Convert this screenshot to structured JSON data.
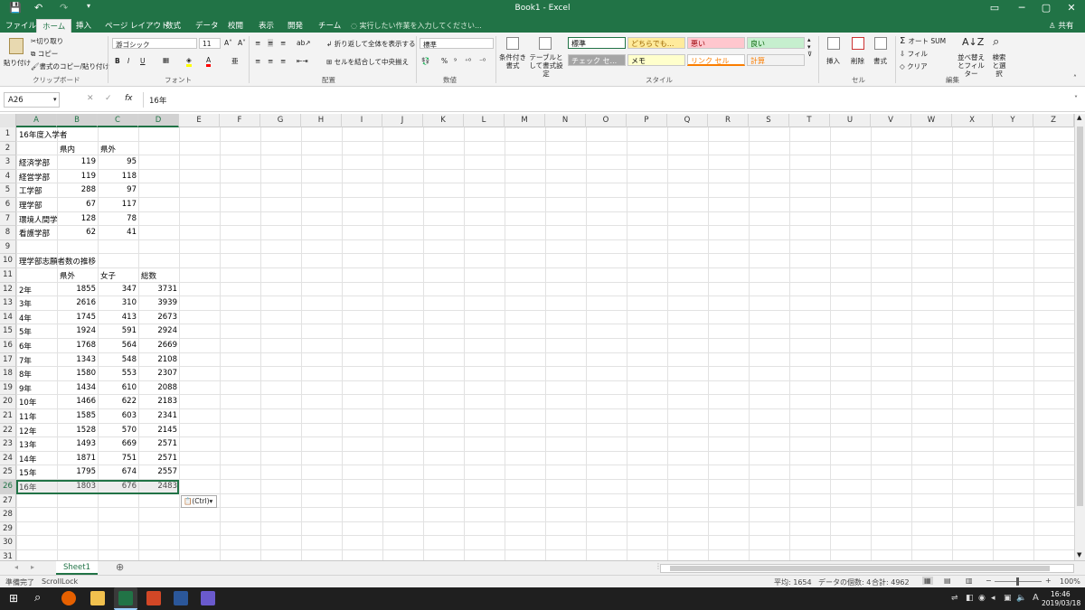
{
  "window": {
    "title": "Book1 - Excel",
    "share": "共有",
    "controls": {
      "ribbon": "▭",
      "min": "─",
      "max": "▢",
      "close": "✕"
    }
  },
  "quick_access": {
    "save": "💾",
    "undo": "↶",
    "redo": "↷",
    "more": "▾"
  },
  "tabs": [
    {
      "label": "ファイル"
    },
    {
      "label": "ホーム"
    },
    {
      "label": "挿入"
    },
    {
      "label": "ページ レイアウト"
    },
    {
      "label": "数式"
    },
    {
      "label": "データ"
    },
    {
      "label": "校閲"
    },
    {
      "label": "表示"
    },
    {
      "label": "開発"
    },
    {
      "label": "チーム"
    }
  ],
  "tell_me": "実行したい作業を入力してください...",
  "ribbon": {
    "clipboard": {
      "paste": "貼り付け",
      "cut": "切り取り",
      "copy": "コピー",
      "format_painter": "書式のコピー/貼り付け",
      "group": "クリップボード"
    },
    "font": {
      "name": "游ゴシック",
      "size": "11",
      "bold": "B",
      "italic": "I",
      "underline": "U",
      "group": "フォント"
    },
    "alignment": {
      "wrap": "折り返して全体を表示する",
      "merge": "セルを結合して中央揃え",
      "group": "配置"
    },
    "number": {
      "format": "標準",
      "percent": "%",
      "comma": "⁹",
      "group": "数値"
    },
    "styles": {
      "conditional": "条件付き書式",
      "table": "テーブルとして書式設定",
      "cells": [
        {
          "label": "標準",
          "bg": "#ffffff",
          "fg": "#000000"
        },
        {
          "label": "どちらでも...",
          "bg": "#ffeb9c",
          "fg": "#9c6500"
        },
        {
          "label": "悪い",
          "bg": "#ffc7ce",
          "fg": "#9c0006"
        },
        {
          "label": "良い",
          "bg": "#c6efce",
          "fg": "#006100"
        },
        {
          "label": "チェック セ...",
          "bg": "#a5a5a5",
          "fg": "#ffffff"
        },
        {
          "label": "メモ",
          "bg": "#ffffcc",
          "fg": "#000000"
        },
        {
          "label": "リンク セル",
          "bg": "#ffffff",
          "fg": "#fa7d00"
        },
        {
          "label": "計算",
          "bg": "#f2f2f2",
          "fg": "#fa7d00"
        }
      ],
      "group": "スタイル"
    },
    "cells": {
      "insert": "挿入",
      "delete": "削除",
      "format": "書式",
      "group": "セル"
    },
    "editing": {
      "autosum": "オート SUM",
      "fill": "フィル",
      "clear": "クリア",
      "sort": "並べ替えとフィルター",
      "find": "検索と選択",
      "group": "編集"
    }
  },
  "formula_bar": {
    "name_box": "A26",
    "cancel": "✕",
    "enter": "✓",
    "fx": "fx",
    "value": "16年"
  },
  "columns": [
    "A",
    "B",
    "C",
    "D",
    "E",
    "F",
    "G",
    "H",
    "I",
    "J",
    "K",
    "L",
    "M",
    "N",
    "O",
    "P",
    "Q",
    "R",
    "S",
    "T",
    "U",
    "V",
    "W",
    "X",
    "Y",
    "Z"
  ],
  "rows": [
    [
      "16年度入学者",
      "",
      "",
      ""
    ],
    [
      "",
      "県内",
      "県外",
      ""
    ],
    [
      "経済学部",
      "119",
      "95",
      ""
    ],
    [
      "経営学部",
      "119",
      "118",
      ""
    ],
    [
      "工学部",
      "288",
      "97",
      ""
    ],
    [
      "理学部",
      "67",
      "117",
      ""
    ],
    [
      "環境人間学",
      "128",
      "78",
      ""
    ],
    [
      "看護学部",
      "62",
      "41",
      ""
    ],
    [
      "",
      "",
      "",
      ""
    ],
    [
      "理学部志願者数の推移",
      "",
      "",
      ""
    ],
    [
      "",
      "県外",
      "女子",
      "総数"
    ],
    [
      "2年",
      "1855",
      "347",
      "3731"
    ],
    [
      "3年",
      "2616",
      "310",
      "3939"
    ],
    [
      "4年",
      "1745",
      "413",
      "2673"
    ],
    [
      "5年",
      "1924",
      "591",
      "2924"
    ],
    [
      "6年",
      "1768",
      "564",
      "2669"
    ],
    [
      "7年",
      "1343",
      "548",
      "2108"
    ],
    [
      "8年",
      "1580",
      "553",
      "2307"
    ],
    [
      "9年",
      "1434",
      "610",
      "2088"
    ],
    [
      "10年",
      "1466",
      "622",
      "2183"
    ],
    [
      "11年",
      "1585",
      "603",
      "2341"
    ],
    [
      "12年",
      "1528",
      "570",
      "2145"
    ],
    [
      "13年",
      "1493",
      "669",
      "2571"
    ],
    [
      "14年",
      "1871",
      "751",
      "2571"
    ],
    [
      "15年",
      "1795",
      "674",
      "2557"
    ],
    [
      "16年",
      "1803",
      "676",
      "2483"
    ],
    [
      "",
      "",
      "",
      ""
    ],
    [
      "",
      "",
      "",
      ""
    ],
    [
      "",
      "",
      "",
      ""
    ],
    [
      "",
      "",
      "",
      ""
    ],
    [
      "",
      "",
      "",
      ""
    ]
  ],
  "paste_options": "(Ctrl)",
  "sheet": {
    "tab": "Sheet1",
    "add": "⊕"
  },
  "status": {
    "ready": "準備完了",
    "scroll_lock": "ScrollLock",
    "average": "平均: 1654",
    "count": "データの個数: 4",
    "sum": "合計: 4962",
    "zoom": "100%"
  },
  "taskbar": {
    "time": "16:46",
    "date": "2019/03/18",
    "ime": "A"
  }
}
